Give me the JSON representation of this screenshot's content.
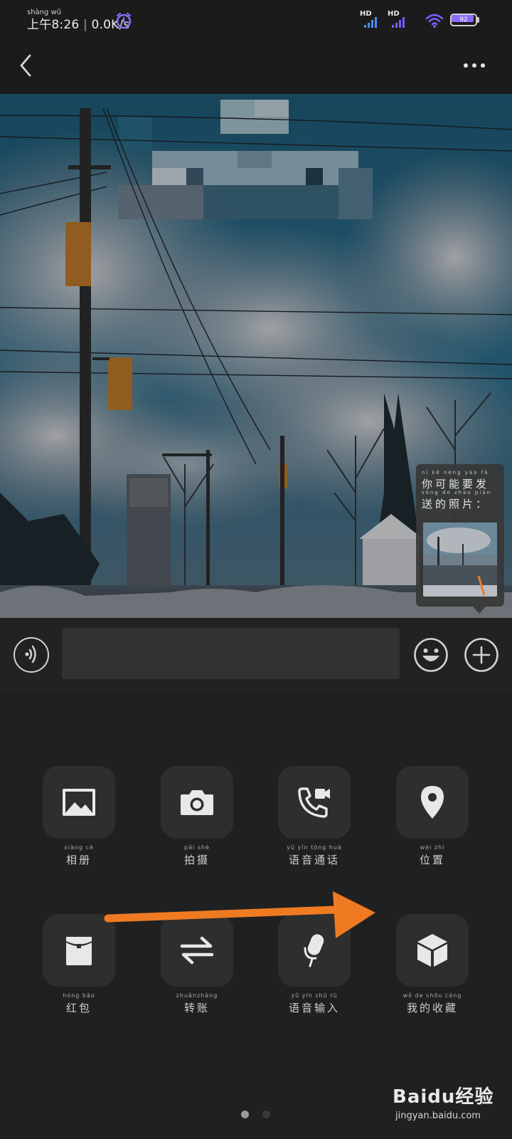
{
  "status_bar": {
    "time_ruby": "shàng wǔ",
    "time": "上午8:26",
    "net_speed": "0.0K/s",
    "sim1_label": "HD",
    "sim2_label": "HD",
    "battery_level": "92",
    "battery_fraction": 0.92,
    "accent_color": "#8a6cff"
  },
  "header": {
    "back_icon": "chevron-left-icon",
    "more_icon": "more-horizontal-icon"
  },
  "suggestion": {
    "line1_ruby": "nǐ  kě néng yào  fā",
    "line1": "你可能要发",
    "line2_ruby": "sòng de zhào piàn",
    "line2": "送的照片："
  },
  "input_bar": {
    "voice_icon": "voice-icon",
    "placeholder": "",
    "emoji_icon": "emoji-icon",
    "plus_icon": "plus-icon"
  },
  "functions": [
    {
      "pinyin": "xiàng  cè",
      "label": "相册",
      "icon": "image-icon"
    },
    {
      "pinyin": "pāi  shè",
      "label": "拍摄",
      "icon": "camera-icon"
    },
    {
      "pinyin": "yǔ  yīn tōng huà",
      "label": "语音通话",
      "icon": "video-call-icon"
    },
    {
      "pinyin": "wèi  zhì",
      "label": "位置",
      "icon": "location-icon"
    },
    {
      "pinyin": "hóng  bāo",
      "label": "红包",
      "icon": "red-packet-icon"
    },
    {
      "pinyin": "zhuǎnzhàng",
      "label": "转账",
      "icon": "transfer-icon"
    },
    {
      "pinyin": "yǔ  yīn shū  rù",
      "label": "语音输入",
      "icon": "microphone-icon"
    },
    {
      "pinyin": "wǒ  de  shōu cáng",
      "label": "我的收藏",
      "icon": "favorites-box-icon"
    }
  ],
  "pager": {
    "current": 1,
    "total": 2
  },
  "annotation": {
    "color": "#f07a22"
  },
  "watermark": {
    "brand": "Baidu经验",
    "site": "jingyan.baidu.com"
  }
}
